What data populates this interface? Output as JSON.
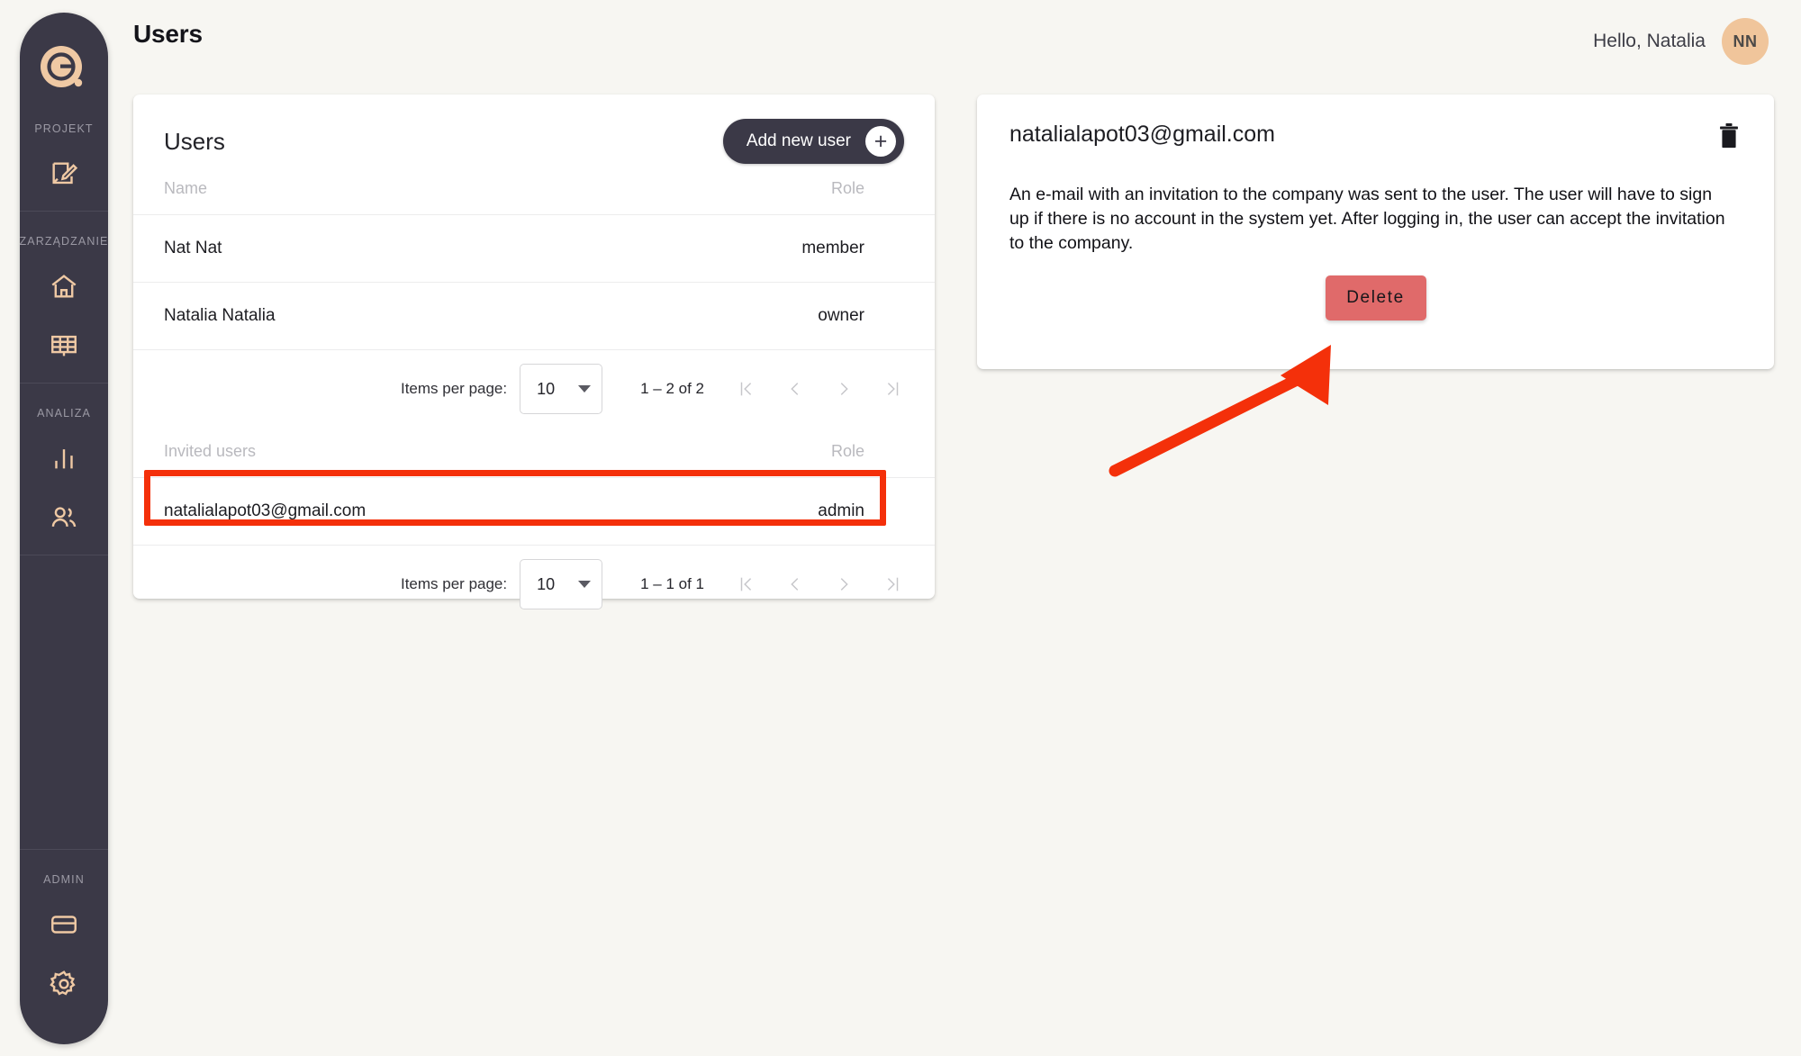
{
  "app": {
    "page_title": "Users",
    "greeting": "Hello, Natalia",
    "avatar_initials": "NN",
    "logo_icon": "e-logo-icon",
    "accent_color": "#efc9a4",
    "sidebar_bg": "#3b3947",
    "page_bg": "#f7f6f2",
    "highlight_color": "#f4300a",
    "delete_color": "#e06a6a"
  },
  "sidebar": {
    "sections": [
      {
        "label": "PROJEKT",
        "items": [
          {
            "icon": "document-edit-icon",
            "name": "sidebar-item-projekt-edit"
          }
        ]
      },
      {
        "label": "ZARZĄDZANIE",
        "items": [
          {
            "icon": "home-icon",
            "name": "sidebar-item-home"
          },
          {
            "icon": "grid-panel-icon",
            "name": "sidebar-item-panels"
          }
        ]
      },
      {
        "label": "ANALIZA",
        "items": [
          {
            "icon": "bar-chart-icon",
            "name": "sidebar-item-analytics"
          },
          {
            "icon": "users-icon",
            "name": "sidebar-item-users"
          }
        ]
      },
      {
        "label": "ADMIN",
        "items": [
          {
            "icon": "credit-card-icon",
            "name": "sidebar-item-billing"
          },
          {
            "icon": "gear-icon",
            "name": "sidebar-item-settings"
          }
        ]
      }
    ]
  },
  "users_card": {
    "title": "Users",
    "add_button_label": "Add new user",
    "add_button_icon": "plus-icon",
    "columns": {
      "name": "Name",
      "role": "Role"
    },
    "rows": [
      {
        "name": "Nat Nat",
        "role": "member"
      },
      {
        "name": "Natalia Natalia",
        "role": "owner"
      }
    ],
    "paginator": {
      "items_per_page_label": "Items per page:",
      "items_per_page_value": "10",
      "range_label": "1 – 2 of 2"
    },
    "invited": {
      "columns": {
        "name": "Invited users",
        "role": "Role"
      },
      "rows": [
        {
          "name": "natalialapot03@gmail.com",
          "role": "admin"
        }
      ],
      "paginator": {
        "items_per_page_label": "Items per page:",
        "items_per_page_value": "10",
        "range_label": "1 – 1 of 1"
      }
    }
  },
  "detail_card": {
    "email": "natalialapot03@gmail.com",
    "trash_icon": "trash-icon",
    "message": "An e-mail with an invitation to the company was sent to the user. The user will have to sign up if there is no account in the system yet. After logging in, the user can accept the invitation to the company.",
    "delete_button_label": "Delete"
  },
  "annotations": {
    "highlight_target": "invited-user-row",
    "arrow_target": "delete-button",
    "arrow_color": "#f4300a"
  }
}
